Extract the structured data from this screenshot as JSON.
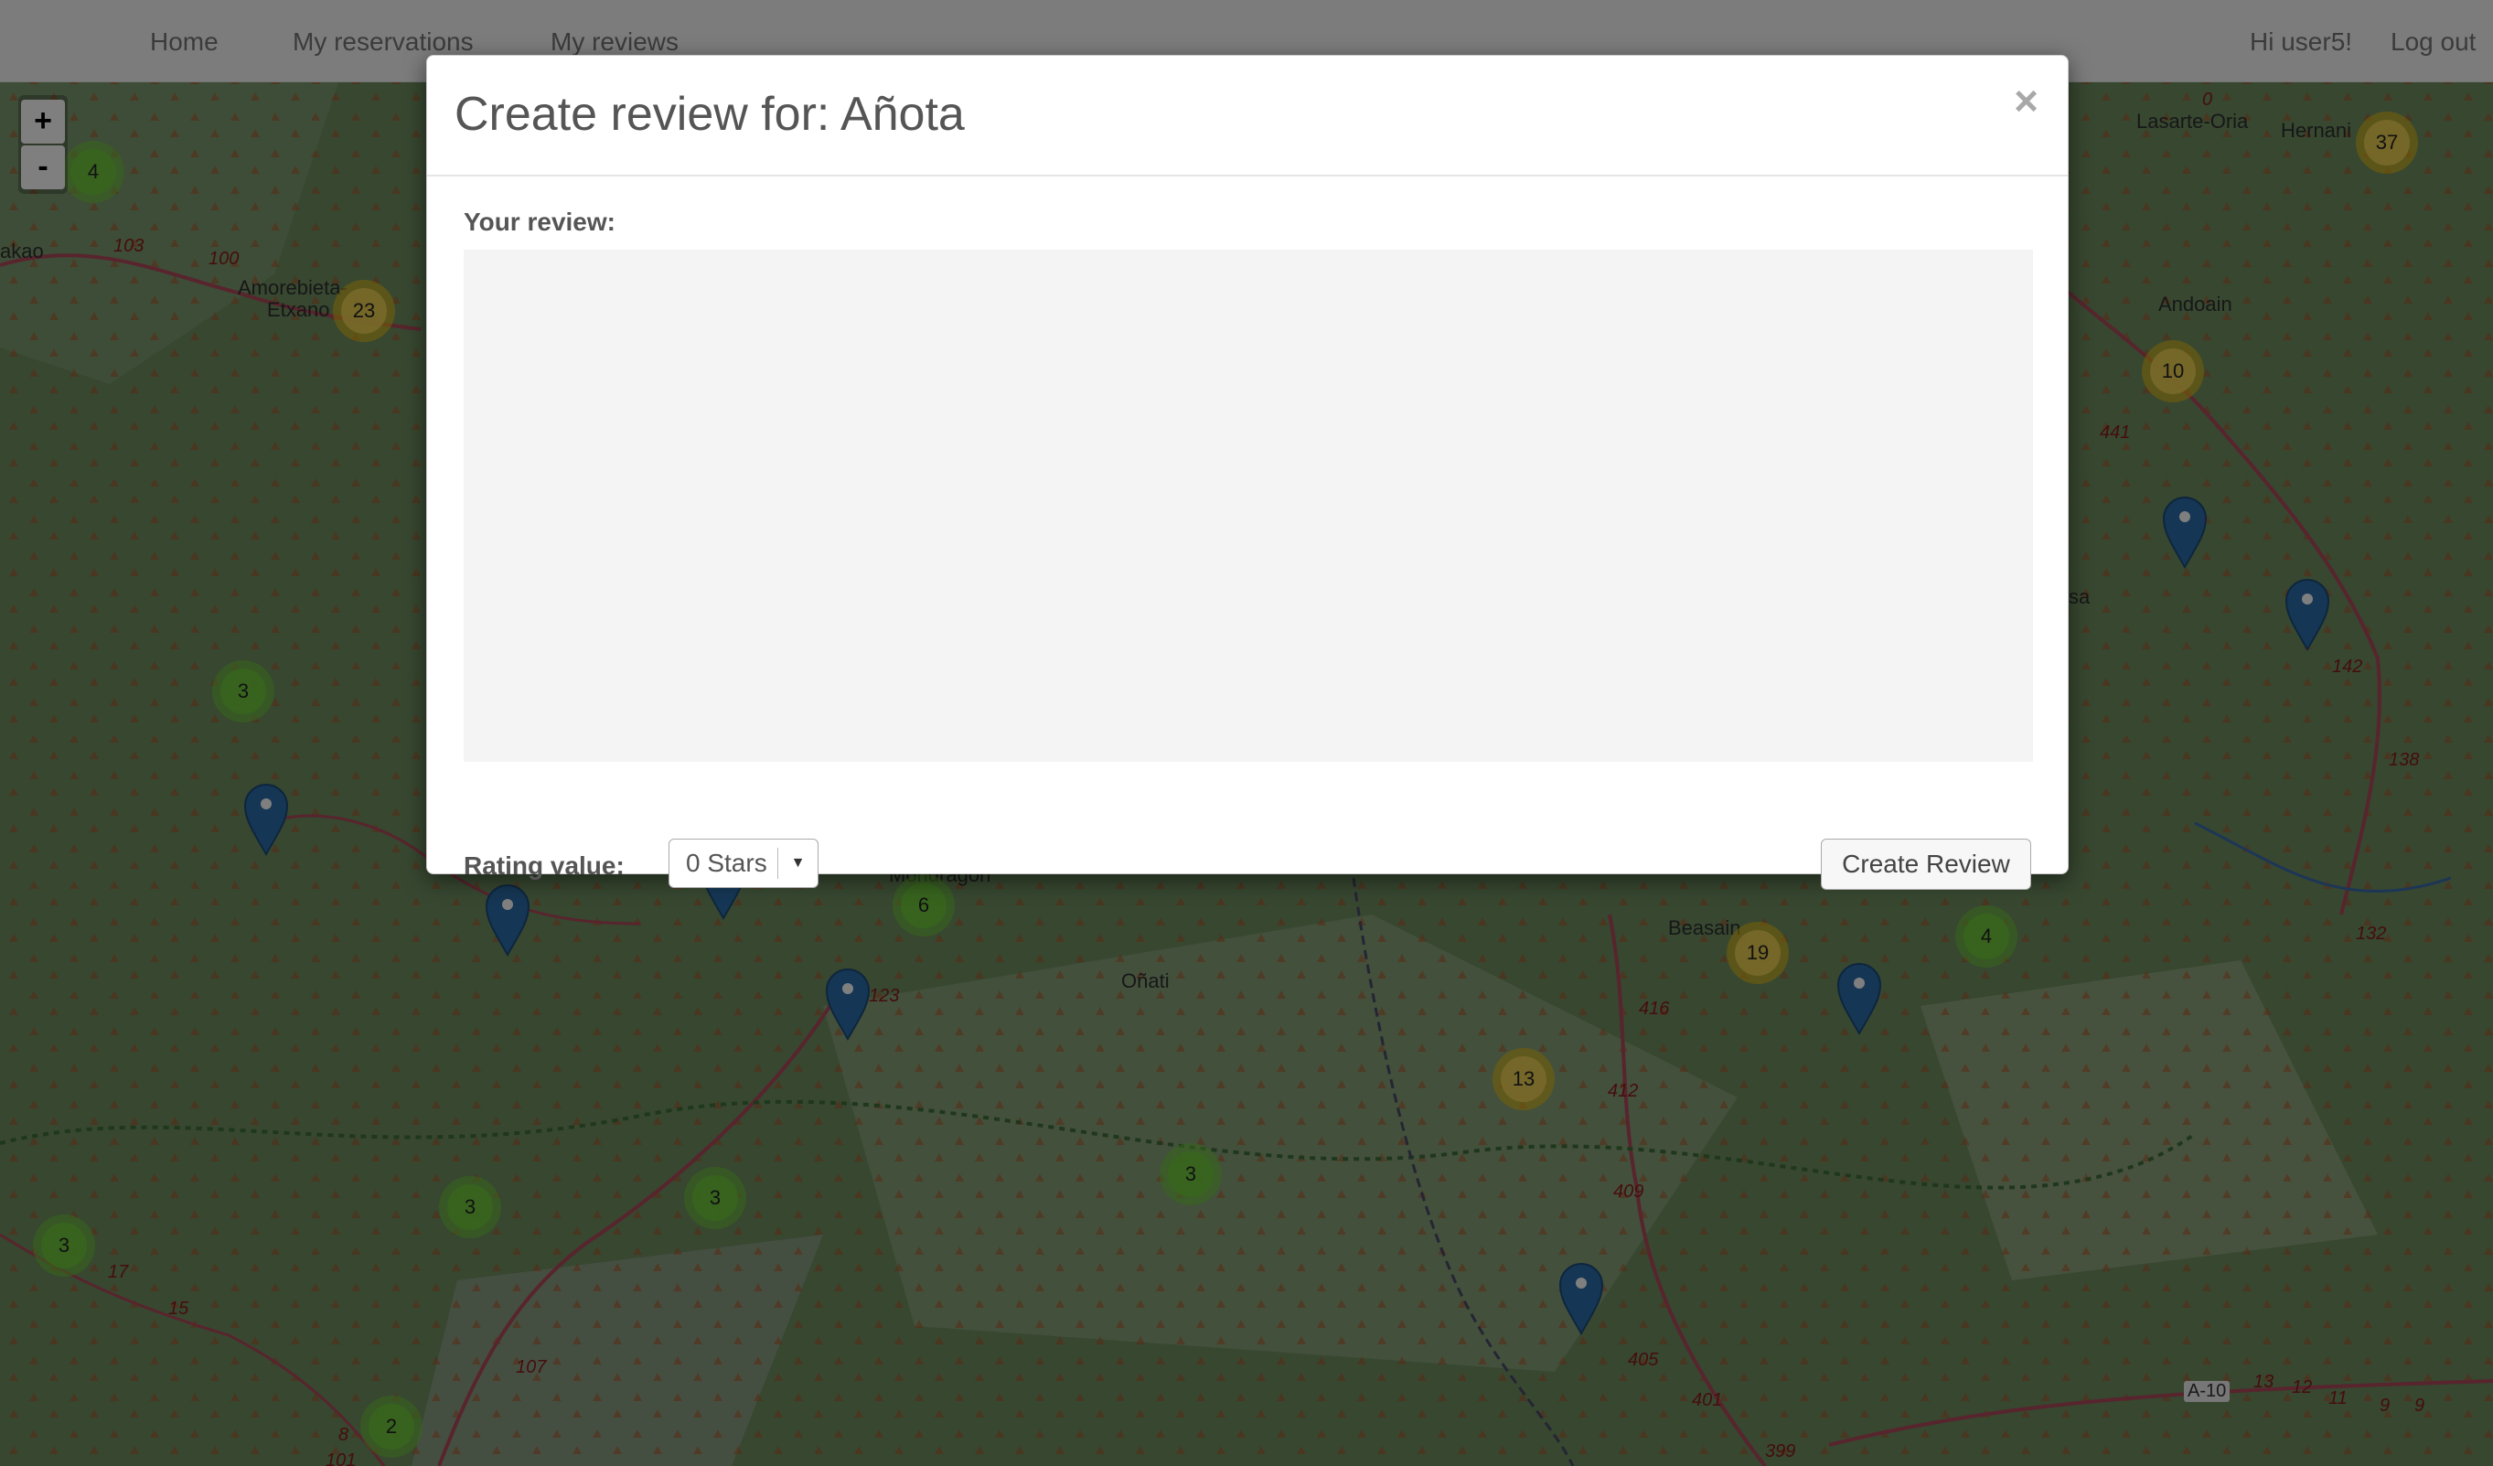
{
  "navbar": {
    "home": "Home",
    "reservations": "My reservations",
    "reviews": "My reviews",
    "greeting": "Hi user5!",
    "logout": "Log out"
  },
  "map": {
    "zoom_in": "+",
    "zoom_out": "-",
    "places": [
      "Lasarte-Oria",
      "Hernani",
      "Andoain",
      "Amorebieta-",
      "Etxano",
      "Oñati",
      "Beasain",
      "akao",
      "Mondragon",
      "sa"
    ],
    "roads": [
      "103",
      "100",
      "0",
      "441",
      "142",
      "138",
      "132",
      "416",
      "412",
      "409",
      "405",
      "401",
      "399",
      "123",
      "107",
      "17",
      "15",
      "8",
      "101",
      "A-10",
      "13",
      "12",
      "11",
      "9",
      "9"
    ],
    "clusters": [
      {
        "count": "4",
        "color": "green"
      },
      {
        "count": "23",
        "color": "yellow"
      },
      {
        "count": "37",
        "color": "yellow"
      },
      {
        "count": "10",
        "color": "yellow"
      },
      {
        "count": "3",
        "color": "green"
      },
      {
        "count": "6",
        "color": "green"
      },
      {
        "count": "19",
        "color": "yellow"
      },
      {
        "count": "4",
        "color": "green"
      },
      {
        "count": "13",
        "color": "yellow"
      },
      {
        "count": "3",
        "color": "green"
      },
      {
        "count": "3",
        "color": "green"
      },
      {
        "count": "3",
        "color": "green"
      },
      {
        "count": "3",
        "color": "green"
      },
      {
        "count": "2",
        "color": "green"
      }
    ]
  },
  "modal": {
    "title": "Create review for: Añota",
    "close": "×",
    "review_label": "Your review:",
    "review_value": "",
    "rating_label": "Rating value:",
    "rating_selected": "0 Stars",
    "submit": "Create Review"
  },
  "colors": {
    "cluster_green": "#6ecc39",
    "cluster_yellow": "#f1d357",
    "pin_blue": "#2b82cb"
  }
}
